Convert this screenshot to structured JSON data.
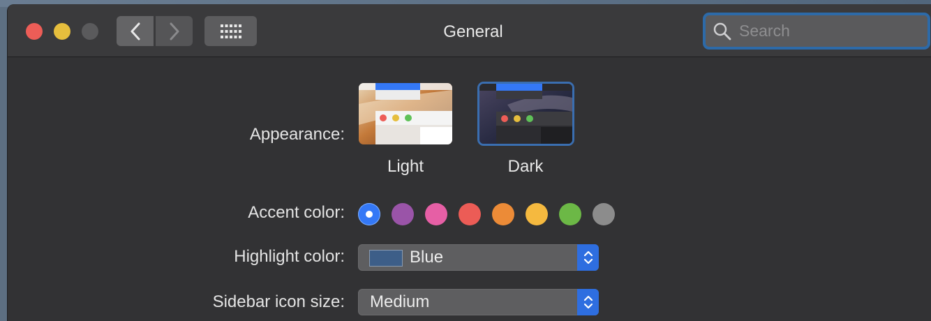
{
  "window": {
    "title": "General"
  },
  "search": {
    "placeholder": "Search"
  },
  "appearance": {
    "label": "Appearance:",
    "options": [
      {
        "name": "Light"
      },
      {
        "name": "Dark",
        "selected": true
      }
    ]
  },
  "accent": {
    "label": "Accent color:",
    "colors": [
      "#3478f6",
      "#9a54a8",
      "#e65fa5",
      "#ec5c56",
      "#ec8b37",
      "#f5b93f",
      "#6cb846",
      "#8c8c8c"
    ],
    "selected_index": 0
  },
  "highlight": {
    "label": "Highlight color:",
    "value": "Blue",
    "swatch": "#3d5e88"
  },
  "sidebar_icon_size": {
    "label": "Sidebar icon size:",
    "value": "Medium"
  },
  "colors": {
    "window_bg": "#323234",
    "titlebar_bg": "#3a3a3c",
    "accent_blue": "#2e6ee0"
  }
}
